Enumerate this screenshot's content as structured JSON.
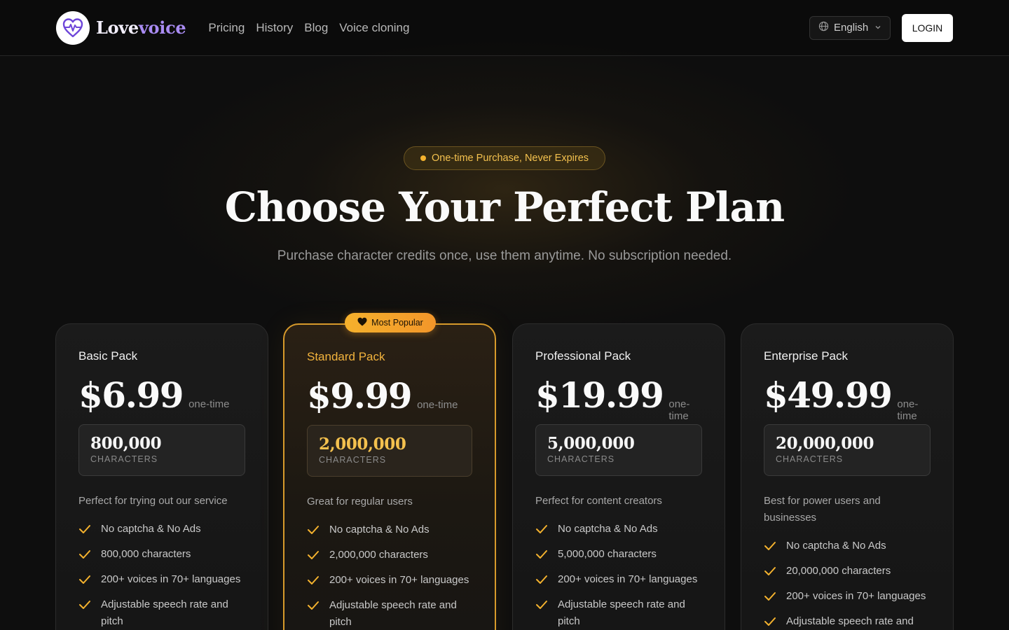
{
  "header": {
    "brand_part1": "Love",
    "brand_part2": "voice",
    "nav": [
      "Pricing",
      "History",
      "Blog",
      "Voice cloning"
    ],
    "language": "English",
    "login": "LOGIN"
  },
  "hero": {
    "pill": "One-time Purchase, Never Expires",
    "title": "Choose Your Perfect Plan",
    "subtitle": "Purchase character credits once, use them anytime. No subscription needed."
  },
  "badge": "Most Popular",
  "plans": [
    {
      "name": "Basic Pack",
      "price": "$6.99",
      "period": "one-time",
      "characters": "800,000",
      "characters_label": "CHARACTERS",
      "description": "Perfect for trying out our service",
      "features": [
        "No captcha & No Ads",
        "800,000 characters",
        "200+ voices in 70+ languages",
        "Adjustable speech rate and pitch"
      ]
    },
    {
      "name": "Standard Pack",
      "price": "$9.99",
      "period": "one-time",
      "characters": "2,000,000",
      "characters_label": "CHARACTERS",
      "description": "Great for regular users",
      "features": [
        "No captcha & No Ads",
        "2,000,000 characters",
        "200+ voices in 70+ languages",
        "Adjustable speech rate and pitch"
      ]
    },
    {
      "name": "Professional Pack",
      "price": "$19.99",
      "period": "one-time",
      "characters": "5,000,000",
      "characters_label": "CHARACTERS",
      "description": "Perfect for content creators",
      "features": [
        "No captcha & No Ads",
        "5,000,000 characters",
        "200+ voices in 70+ languages",
        "Adjustable speech rate and pitch"
      ]
    },
    {
      "name": "Enterprise Pack",
      "price": "$49.99",
      "period": "one-time",
      "characters": "20,000,000",
      "characters_label": "CHARACTERS",
      "description": "Best for power users and businesses",
      "features": [
        "No captcha & No Ads",
        "20,000,000 characters",
        "200+ voices in 70+ languages",
        "Adjustable speech rate and pitch"
      ]
    }
  ],
  "colors": {
    "accent_gold": "#f4b22e",
    "brand_purple": "#a98bf2",
    "background": "#0e0e0e"
  }
}
